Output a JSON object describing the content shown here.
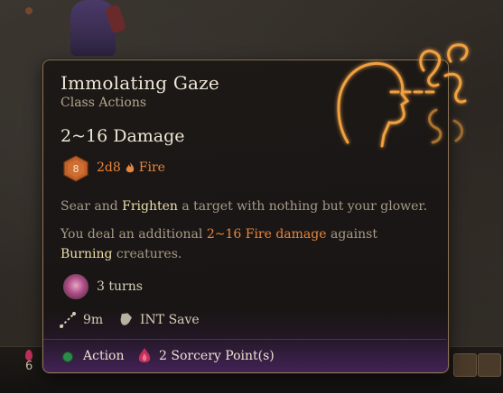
{
  "spell": {
    "title": "Immolating Gaze",
    "category": "Class Actions",
    "damage_heading": "2~16 Damage",
    "die_face": "8",
    "dice": "2d8",
    "damage_type": "Fire",
    "description_1": {
      "pre": "Sear and ",
      "keyword": "Frighten",
      "post": " a target with nothing but your glower."
    },
    "description_2": {
      "pre": "You deal an additional ",
      "fire": "2~16 Fire damage",
      "mid": " against ",
      "keyword": "Burning",
      "post": " creatures."
    },
    "duration": "3 turns",
    "range": "9m",
    "save": "INT Save",
    "cost_action": "Action",
    "cost_resource": "2 Sorcery Point(s)"
  },
  "hotbar": {
    "count": "6"
  },
  "colors": {
    "fire": "#e8863a",
    "keyword": "#eddfa8",
    "action": "#2f8a4a",
    "sorcery": "#c0305a",
    "art_glow": "#e0903a"
  },
  "icons": {
    "spell_art": "head-with-flames-icon",
    "die": "d8-die-icon",
    "fire": "flame-icon",
    "duration": "frightened-condition-icon",
    "range": "range-icon",
    "save": "save-shield-icon",
    "action": "action-dot-icon",
    "sorcery": "sorcery-point-icon"
  }
}
